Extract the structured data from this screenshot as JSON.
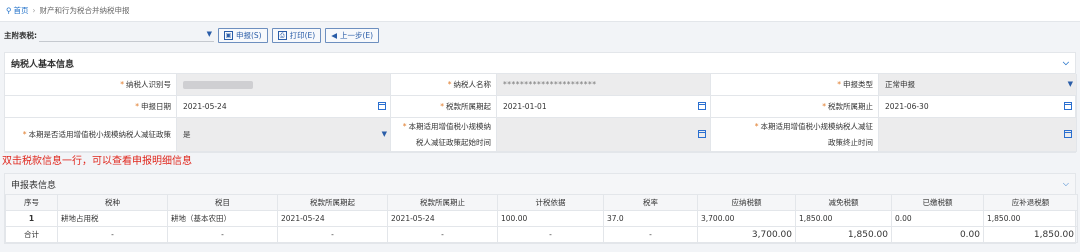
{
  "breadcrumb": {
    "home": "首页",
    "current": "财产和行为税合并纳税申报"
  },
  "toolbar": {
    "label": "主附表税:",
    "select_value": "",
    "btn_declare": "申报(S)",
    "btn_print": "打印(E)",
    "btn_prev": "上一步(E)"
  },
  "basic_info": {
    "title": "纳税人基本信息",
    "taxpayer_id_label": "纳税人识别号",
    "taxpayer_id_value": "",
    "taxpayer_name_label": "纳税人名称",
    "taxpayer_name_value": "**********************",
    "declare_type_label": "申报类型",
    "declare_type_value": "正常申报",
    "declare_date_label": "申报日期",
    "declare_date_value": "2021-05-24",
    "period_start_label": "税款所属期起",
    "period_start_value": "2021-01-01",
    "period_end_label": "税款所属期止",
    "period_end_value": "2021-06-30",
    "policy_label": "本期是否适用增值税小规模纳税人减征政策",
    "policy_value": "是",
    "policy_start_label_1": "本期适用增值税小规模纳",
    "policy_start_label_2": "税人减征政策起始时间",
    "policy_end_label_1": "本期适用增值税小规模纳税人减征",
    "policy_end_label_2": "政策终止时间"
  },
  "hint": "双击税款信息一行，可以查看申报明细信息",
  "report": {
    "title": "申报表信息",
    "headers": [
      "序号",
      "税种",
      "税目",
      "税款所属期起",
      "税款所属期止",
      "计税依据",
      "税率",
      "应纳税额",
      "减免税额",
      "已缴税额",
      "应补退税额"
    ],
    "rows": [
      [
        "1",
        "耕地占用税",
        "耕地（基本农田）",
        "2021-05-24",
        "2021-05-24",
        "100.00",
        "37.0",
        "3,700.00",
        "1,850.00",
        "0.00",
        "1,850.00"
      ]
    ],
    "total": [
      "合计",
      "-",
      "-",
      "-",
      "-",
      "-",
      "-",
      "3,700.00",
      "1,850.00",
      "0.00",
      "1,850.00"
    ]
  }
}
